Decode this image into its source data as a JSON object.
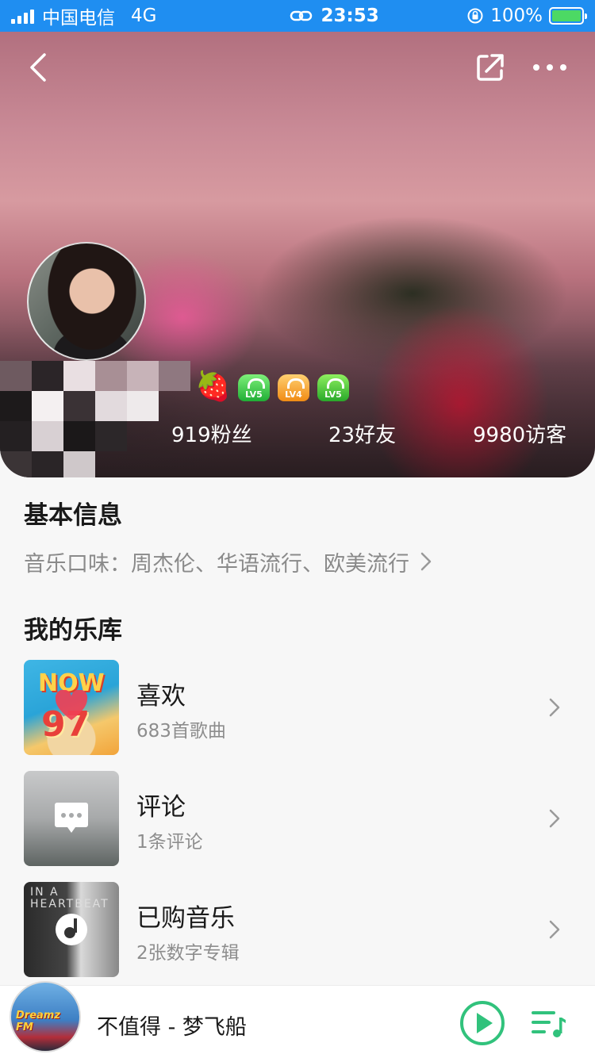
{
  "status_bar": {
    "carrier": "中国电信",
    "network": "4G",
    "time": "23:53",
    "battery": "100%"
  },
  "profile": {
    "name_emoji": "🍓",
    "level_badges": [
      "LV5",
      "LV4",
      "LV5"
    ],
    "stats": {
      "fans": "919粉丝",
      "friends": "23好友",
      "visitors": "9980访客"
    }
  },
  "basic_info": {
    "title": "基本信息",
    "music_taste": "音乐口味：周杰伦、华语流行、欧美流行"
  },
  "library": {
    "title": "我的乐库",
    "items": [
      {
        "name": "喜欢",
        "sub": "683首歌曲",
        "cover_text_1": "NOW",
        "cover_text_2": "97"
      },
      {
        "name": "评论",
        "sub": "1条评论"
      },
      {
        "name": "已购音乐",
        "sub": "2张数字专辑",
        "cover_text": "IN A HEARTBEAT"
      }
    ]
  },
  "player": {
    "title": "不值得 - 梦飞船",
    "cover_text": "Dreamz FM"
  },
  "colors": {
    "status_bar": "#1f8ef1",
    "accent_green": "#31c27c",
    "background": "#f7f7f7"
  }
}
